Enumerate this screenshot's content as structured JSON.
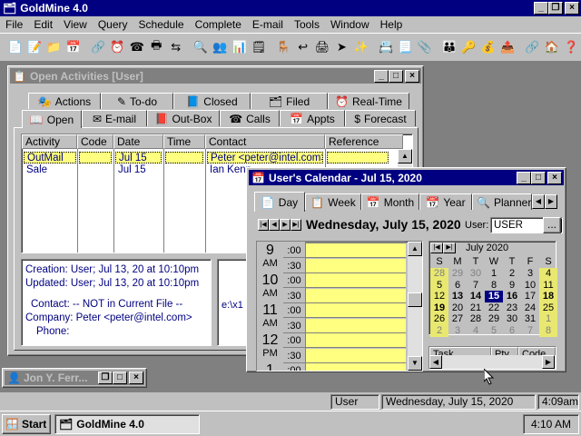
{
  "app": {
    "title": "GoldMine 4.0"
  },
  "menu": [
    "File",
    "Edit",
    "View",
    "Query",
    "Schedule",
    "Complete",
    "E-mail",
    "Tools",
    "Window",
    "Help"
  ],
  "activities_window": {
    "title": "Open Activities [User]",
    "tabs_row1": [
      {
        "label": "Actions",
        "icon": "🎭"
      },
      {
        "label": "To-do",
        "icon": "✎"
      },
      {
        "label": "Closed",
        "icon": "📘"
      },
      {
        "label": "Filed",
        "icon": "🗂"
      },
      {
        "label": "Real-Time",
        "icon": "⏰"
      }
    ],
    "tabs_row2": [
      {
        "label": "Open",
        "icon": "📖"
      },
      {
        "label": "E-mail",
        "icon": "✉"
      },
      {
        "label": "Out-Box",
        "icon": "📕"
      },
      {
        "label": "Calls",
        "icon": "☎"
      },
      {
        "label": "Appts",
        "icon": "📅"
      },
      {
        "label": "Forecast",
        "icon": "$"
      }
    ],
    "columns": [
      "Activity",
      "Code",
      "Date",
      "Time",
      "Contact",
      "Reference"
    ],
    "rows": [
      {
        "activity": "OutMail",
        "code": "",
        "date": "Jul 15",
        "time": "",
        "contact": "Peter <peter@intel.com>",
        "reference": ""
      },
      {
        "activity": "Sale",
        "code": "",
        "date": "Jul 15",
        "time": "",
        "contact": "Ian Kenn",
        "reference": ""
      }
    ],
    "details": {
      "creation": "Creation: User; Jul 13, 20 at 10:10pm",
      "updated": "Updated: User; Jul 13, 20 at 10:10pm",
      "contact_line": "Contact:  -- NOT in Current File --",
      "company_line": "Company: Peter <peter@intel.com>",
      "phone_line": "Phone:"
    },
    "path_text": "e:\\x1"
  },
  "minimized_window": {
    "title": "Jon Y. Ferr..."
  },
  "calendar_window": {
    "title": "User's Calendar - Jul 15, 2020",
    "tabs": [
      {
        "label": "Day",
        "icon": "📄"
      },
      {
        "label": "Week",
        "icon": "📋"
      },
      {
        "label": "Month",
        "icon": "📅"
      },
      {
        "label": "Year",
        "icon": "📆"
      },
      {
        "label": "Planner",
        "icon": "🔍"
      }
    ],
    "date_heading": "Wednesday, July 15, 2020",
    "user_label": "User:",
    "user_value": "USER",
    "more_button": "...",
    "hours": [
      {
        "hour": "9",
        "ampm": "AM"
      },
      {
        "hour": "10",
        "ampm": "AM"
      },
      {
        "hour": "11",
        "ampm": "AM"
      },
      {
        "hour": "12",
        "ampm": "PM"
      },
      {
        "hour": "1",
        "ampm": ""
      }
    ],
    "minutes": [
      ":00",
      ":30"
    ],
    "mini_month": {
      "title": "July 2020",
      "weekdays": [
        "S",
        "M",
        "T",
        "W",
        "T",
        "F",
        "S"
      ],
      "weeks": [
        [
          "28",
          "29",
          "30",
          "1",
          "2",
          "3",
          "4"
        ],
        [
          "5",
          "6",
          "7",
          "8",
          "9",
          "10",
          "11"
        ],
        [
          "12",
          "13",
          "14",
          "15",
          "16",
          "17",
          "18"
        ],
        [
          "19",
          "20",
          "21",
          "22",
          "23",
          "24",
          "25"
        ],
        [
          "26",
          "27",
          "28",
          "29",
          "30",
          "31",
          "1"
        ],
        [
          "2",
          "3",
          "4",
          "5",
          "6",
          "7",
          "8"
        ]
      ],
      "today": "15"
    },
    "task_columns": [
      "Task",
      "Pty",
      "Code"
    ]
  },
  "status_bar": {
    "user": "User",
    "date": "Wednesday, July 15, 2020",
    "time": "4:09am"
  },
  "taskbar": {
    "start_label": "Start",
    "task_label": "GoldMine 4.0",
    "clock": "4:10 AM"
  },
  "colors": {
    "title_active": "#000080",
    "face": "#c0c0c0",
    "desktop": "#808080",
    "calendar_slot": "#ffff80",
    "link_blue": "#000080"
  }
}
